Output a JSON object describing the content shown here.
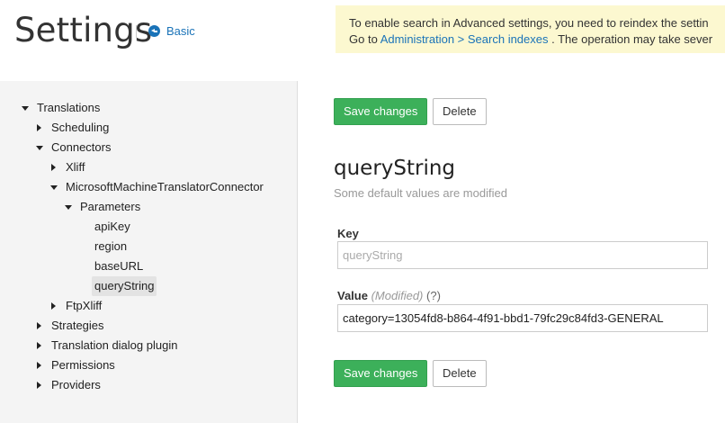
{
  "header": {
    "title": "Settings",
    "basic_link": "Basic"
  },
  "notice": {
    "line1": "To enable search in Advanced settings, you need to reindex the settin",
    "line2_prefix": "Go to",
    "link": "Administration > Search indexes",
    "line2_suffix": ". The operation may take sever"
  },
  "tree": {
    "items": [
      {
        "label": "Translations",
        "state": "expanded",
        "depth": 0
      },
      {
        "label": "Scheduling",
        "state": "collapsed",
        "depth": 1
      },
      {
        "label": "Connectors",
        "state": "expanded",
        "depth": 1
      },
      {
        "label": "Xliff",
        "state": "collapsed",
        "depth": 2
      },
      {
        "label": "MicrosoftMachineTranslatorConnector",
        "state": "expanded",
        "depth": 2
      },
      {
        "label": "Parameters",
        "state": "expanded",
        "depth": 3
      },
      {
        "label": "apiKey",
        "state": "leaf",
        "depth": 4
      },
      {
        "label": "region",
        "state": "leaf",
        "depth": 4
      },
      {
        "label": "baseURL",
        "state": "leaf",
        "depth": 4
      },
      {
        "label": "queryString",
        "state": "leaf-selected",
        "depth": 4
      },
      {
        "label": "FtpXliff",
        "state": "collapsed",
        "depth": 2
      },
      {
        "label": "Strategies",
        "state": "collapsed",
        "depth": 1
      },
      {
        "label": "Translation dialog plugin",
        "state": "collapsed",
        "depth": 1
      },
      {
        "label": "Permissions",
        "state": "collapsed",
        "depth": 1
      },
      {
        "label": "Providers",
        "state": "collapsed",
        "depth": 1
      }
    ]
  },
  "main": {
    "save_label": "Save changes",
    "delete_label": "Delete",
    "title": "queryString",
    "subtitle": "Some default values are modified",
    "key_label": "Key",
    "key_placeholder": "queryString",
    "value_label": "Value",
    "value_modified": "(Modified)",
    "value_help": "(?)",
    "value": "category=13054fd8-b864-4f91-bbd1-79fc29c84fd3-GENERAL"
  }
}
